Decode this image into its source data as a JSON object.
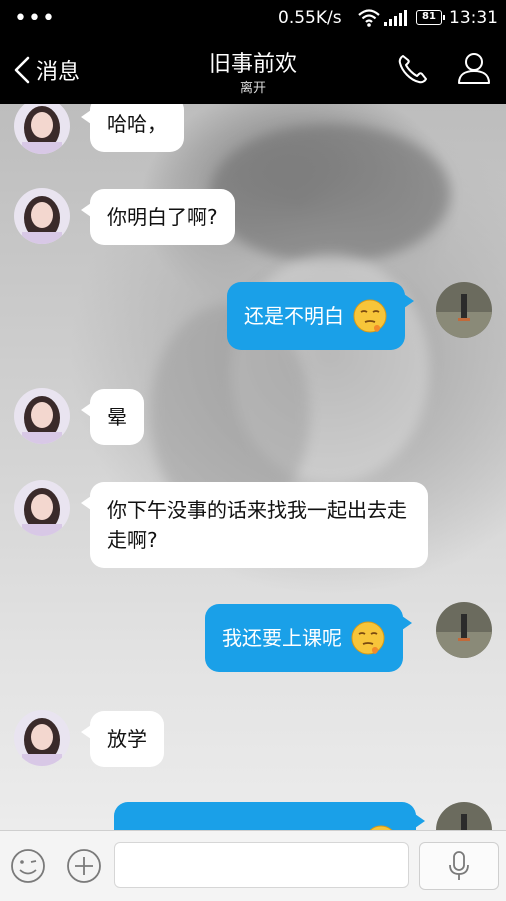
{
  "status_bar": {
    "dots": "•••",
    "network_speed": "0.55K/s",
    "battery_level": "81",
    "time": "13:31"
  },
  "header": {
    "back_label": "消息",
    "title": "旧事前欢",
    "status": "离开"
  },
  "messages": [
    {
      "side": "left",
      "text": "哈哈，",
      "emoji": null
    },
    {
      "side": "left",
      "text": "你明白了啊?",
      "emoji": null
    },
    {
      "side": "right",
      "text": "还是不明白",
      "emoji": "smug-emoji"
    },
    {
      "side": "left",
      "text": "晕",
      "emoji": null
    },
    {
      "side": "left",
      "text": "你下午没事的话来找我一起出去走走啊?",
      "emoji": null
    },
    {
      "side": "right",
      "text": "我还要上课呢",
      "emoji": "smug-emoji"
    },
    {
      "side": "left",
      "text": "放学",
      "emoji": null
    },
    {
      "side": "right",
      "text": "",
      "emoji": "smug-emoji"
    }
  ],
  "input_bar": {
    "placeholder": "",
    "emoji_button_icon": "smiley-icon",
    "plus_button_icon": "plus-icon",
    "voice_button_icon": "microphone-icon"
  },
  "colors": {
    "outgoing_bubble": "#1aa0e8",
    "incoming_bubble": "#ffffff",
    "header_bg": "#000000"
  }
}
